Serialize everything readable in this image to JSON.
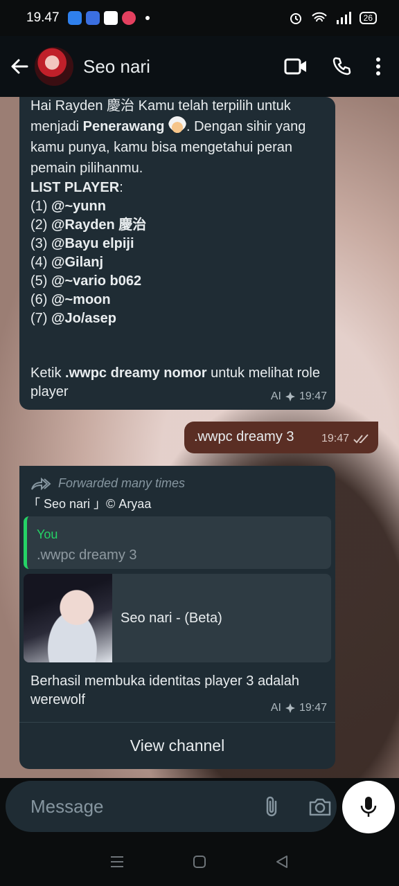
{
  "status_bar": {
    "time": "19.47",
    "battery": "26"
  },
  "header": {
    "contact_name": "Seo nari"
  },
  "messages": {
    "m1": {
      "intro_1": "Hai Rayden 慶治 Kamu telah terpilih  untuk menjadi ",
      "role": "Penerawang",
      "intro_2": ". Dengan sihir yang kamu punya, kamu bisa mengetahui peran pemain pilihanmu.",
      "list_title": "LIST PLAYER",
      "list_colon": ":",
      "players": [
        {
          "num": "(1) ",
          "name": "@~yunn"
        },
        {
          "num": "(2) ",
          "name": "@Rayden 慶治"
        },
        {
          "num": "(3) ",
          "name": "@Bayu elpiji"
        },
        {
          "num": "(4) ",
          "name": "@Gilanj"
        },
        {
          "num": "(5) ",
          "name": "@~vario b062"
        },
        {
          "num": "(6) ",
          "name": "@~moon"
        },
        {
          "num": "(7) ",
          "name": "@Jo/asep"
        }
      ],
      "instruction_1": "Ketik ",
      "command": ".wwpc dreamy nomor",
      "instruction_2": " untuk melihat role player",
      "ai_label": "AI",
      "time": "19:47"
    },
    "m2": {
      "text": ".wwpc dreamy 3",
      "time": "19:47"
    },
    "m3": {
      "forwarded": "Forwarded many times",
      "sender": "「 Seo nari 」© Aryaa",
      "quote_name": "You",
      "quote_text": ".wwpc dreamy 3",
      "card_title": "Seo nari - (Beta)",
      "text": "Berhasil membuka identitas player 3 adalah werewolf",
      "ai_label": "AI",
      "time": "19:47",
      "button": "View channel"
    }
  },
  "composer": {
    "placeholder": "Message"
  },
  "colors": {
    "accent": "#25d366",
    "bubble_in": "#1f2c34",
    "bubble_out": "#5a2e24"
  },
  "icons": [
    "back-arrow-icon",
    "video-call-icon",
    "phone-icon",
    "more-options-icon",
    "forward-icon",
    "emoji-icon",
    "attach-icon",
    "camera-icon",
    "mic-icon",
    "ai-sparkle-icon",
    "double-check-icon"
  ]
}
